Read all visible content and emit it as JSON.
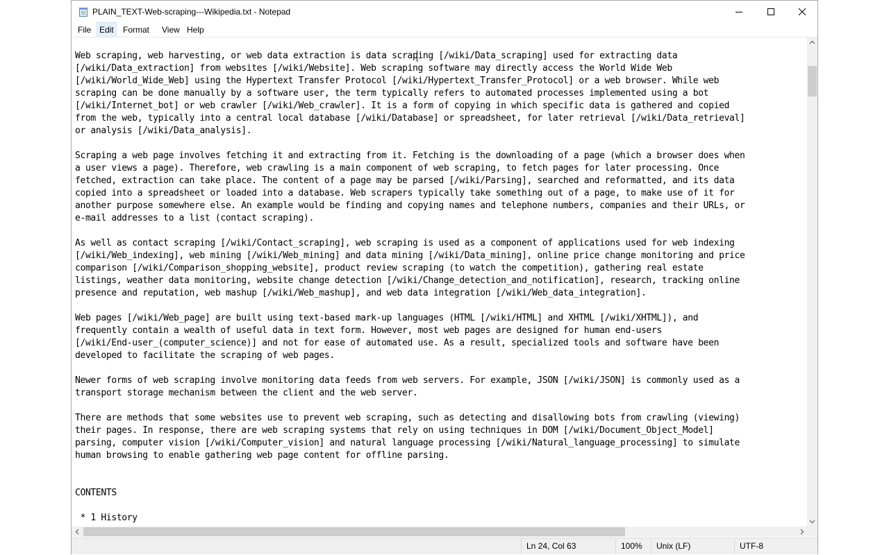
{
  "window": {
    "title": "PLAIN_TEXT-Web-scraping---Wikipedia.txt - Notepad"
  },
  "menu": {
    "file": "File",
    "edit": "Edit",
    "format": "Format",
    "view": "View",
    "help": "Help"
  },
  "editor": {
    "content": "Web scraping, web harvesting, or web data extraction is data scraping [/wiki/Data_scraping] used for extracting data\n[/wiki/Data_extraction] from websites [/wiki/Website]. Web scraping software may directly access the World Wide Web\n[/wiki/World_Wide_Web] using the Hypertext Transfer Protocol [/wiki/Hypertext_Transfer_Protocol] or a web browser. While web\nscraping can be done manually by a software user, the term typically refers to automated processes implemented using a bot\n[/wiki/Internet_bot] or web crawler [/wiki/Web_crawler]. It is a form of copying in which specific data is gathered and copied\nfrom the web, typically into a central local database [/wiki/Database] or spreadsheet, for later retrieval [/wiki/Data_retrieval]\nor analysis [/wiki/Data_analysis].\n\nScraping a web page involves fetching it and extracting from it. Fetching is the downloading of a page (which a browser does when\na user views a page). Therefore, web crawling is a main component of web scraping, to fetch pages for later processing. Once\nfetched, extraction can take place. The content of a page may be parsed [/wiki/Parsing], searched and reformatted, and its data\ncopied into a spreadsheet or loaded into a database. Web scrapers typically take something out of a page, to make use of it for\nanother purpose somewhere else. An example would be finding and copying names and telephone numbers, companies and their URLs, or\ne-mail addresses to a list (contact scraping).\n\nAs well as contact scraping [/wiki/Contact_scraping], web scraping is used as a component of applications used for web indexing\n[/wiki/Web_indexing], web mining [/wiki/Web_mining] and data mining [/wiki/Data_mining], online price change monitoring and price\ncomparison [/wiki/Comparison_shopping_website], product review scraping (to watch the competition), gathering real estate\nlistings, weather data monitoring, website change detection [/wiki/Change_detection_and_notification], research, tracking online\npresence and reputation, web mashup [/wiki/Web_mashup], and web data integration [/wiki/Web_data_integration].\n\nWeb pages [/wiki/Web_page] are built using text-based mark-up languages (HTML [/wiki/HTML] and XHTML [/wiki/XHTML]), and\nfrequently contain a wealth of useful data in text form. However, most web pages are designed for human end-users\n[/wiki/End-user_(computer_science)] and not for ease of automated use. As a result, specialized tools and software have been\ndeveloped to facilitate the scraping of web pages.\n\nNewer forms of web scraping involve monitoring data feeds from web servers. For example, JSON [/wiki/JSON] is commonly used as a\ntransport storage mechanism between the client and the web server.\n\nThere are methods that some websites use to prevent web scraping, such as detecting and disallowing bots from crawling (viewing)\ntheir pages. In response, there are web scraping systems that rely on using techniques in DOM [/wiki/Document_Object_Model]\nparsing, computer vision [/wiki/Computer_vision] and natural language processing [/wiki/Natural_language_processing] to simulate\nhuman browsing to enable gathering web page content for offline parsing.\n\n\nCONTENTS\n\n * 1 History"
  },
  "status": {
    "position": "Ln 24, Col 63",
    "zoom": "100%",
    "line_ending": "Unix (LF)",
    "encoding": "UTF-8"
  },
  "icons": {
    "app": "notepad-icon",
    "minimize": "minimize-icon",
    "maximize": "maximize-icon",
    "close": "close-icon"
  }
}
